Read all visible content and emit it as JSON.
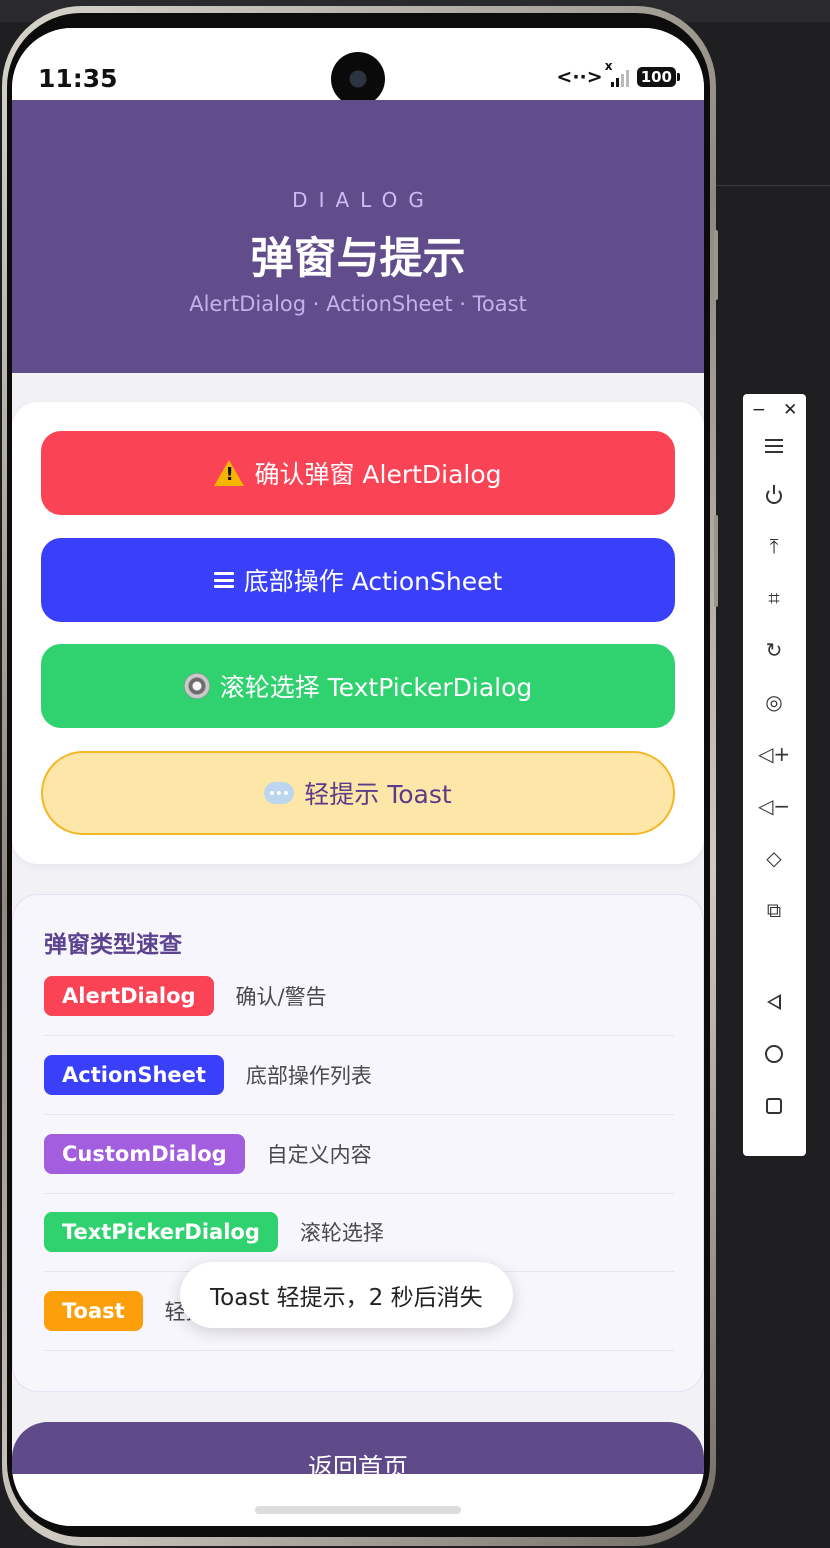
{
  "status_bar": {
    "time": "11:35",
    "net_arrows": "<··>",
    "signal_x": "x",
    "battery": "100"
  },
  "header": {
    "kicker": "DIALOG",
    "title": "弹窗与提示",
    "subtitle": "AlertDialog · ActionSheet · Toast",
    "background": "#624d8c"
  },
  "buttons": [
    {
      "label": "确认弹窗 AlertDialog",
      "icon": "warning-icon",
      "color": "#fb4356"
    },
    {
      "label": "底部操作 ActionSheet",
      "icon": "menu-icon",
      "color": "#3a40fa"
    },
    {
      "label": "滚轮选择 TextPickerDialog",
      "icon": "gear-icon",
      "color": "#30d16f"
    },
    {
      "label": "轻提示 Toast",
      "icon": "speech-bubble-icon",
      "color": "#fde7a8"
    }
  ],
  "reference": {
    "title": "弹窗类型速查",
    "rows": [
      {
        "tag": "AlertDialog",
        "desc": "确认/警告",
        "color": "#fb4356"
      },
      {
        "tag": "ActionSheet",
        "desc": "底部操作列表",
        "color": "#3a40fa"
      },
      {
        "tag": "CustomDialog",
        "desc": "自定义内容",
        "color": "#a35ee0"
      },
      {
        "tag": "TextPickerDialog",
        "desc": "滚轮选择",
        "color": "#30d16f"
      },
      {
        "tag": "Toast",
        "desc": "轻提示",
        "color": "#fd9f0a"
      }
    ]
  },
  "home_button": {
    "label": "返回首页"
  },
  "toast": {
    "text": "Toast 轻提示，2 秒后消失"
  },
  "toolbar": {
    "minimize": "−",
    "close": "✕",
    "items": [
      "menu-icon",
      "power-icon",
      "pin-to-top-icon",
      "crop-icon",
      "rotate-icon",
      "screenshot-icon",
      "volume-up-icon",
      "volume-down-icon",
      "fold-icon",
      "multi-device-icon",
      "back-icon",
      "home-icon",
      "recents-icon"
    ]
  }
}
